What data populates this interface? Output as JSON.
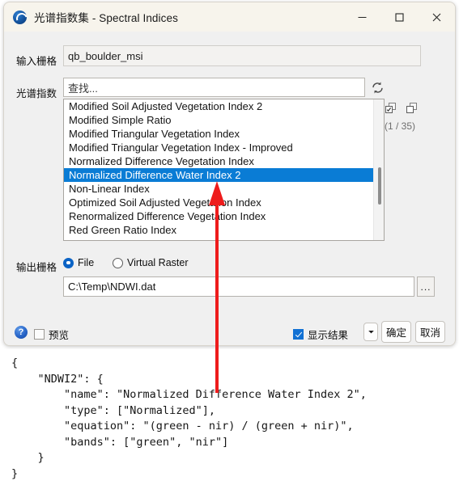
{
  "window": {
    "title": "光谱指数集 - Spectral Indices",
    "app_icon": "globe-swirl-icon",
    "controls": {
      "minimize": "minimize-icon",
      "maximize": "maximize-icon",
      "close": "close-icon"
    }
  },
  "form": {
    "input_raster_label": "输入栅格",
    "input_raster_value": "qb_boulder_msi",
    "spectral_index_label": "光谱指数",
    "search_placeholder": "查找...",
    "refresh_icon": "refresh-icon",
    "select_all_icon": "select-all-icon",
    "deselect_all_icon": "deselect-all-icon",
    "selection_count": "(1 / 35)",
    "list_items": [
      {
        "label": "Modified Soil Adjusted Vegetation Index 2",
        "selected": false
      },
      {
        "label": "Modified Simple Ratio",
        "selected": false
      },
      {
        "label": "Modified Triangular Vegetation Index",
        "selected": false
      },
      {
        "label": "Modified Triangular Vegetation Index - Improved",
        "selected": false
      },
      {
        "label": "Normalized Difference Vegetation Index",
        "selected": false
      },
      {
        "label": "Normalized Difference Water Index 2",
        "selected": true
      },
      {
        "label": "Non-Linear Index",
        "selected": false
      },
      {
        "label": "Optimized Soil Adjusted Vegetation Index",
        "selected": false
      },
      {
        "label": "Renormalized Difference Vegetation Index",
        "selected": false
      },
      {
        "label": "Red Green Ratio Index",
        "selected": false
      }
    ],
    "output_raster_label": "输出栅格",
    "output_file_option": "File",
    "output_virtual_option": "Virtual Raster",
    "output_selected": "File",
    "output_path": "C:\\Temp\\NDWI.dat",
    "browse_label": "..."
  },
  "footer": {
    "help_label": "?",
    "preview_label": "预览",
    "preview_checked": false,
    "display_result_label": "显示结果",
    "display_result_checked": true,
    "dropdown_icon": "chevron-down-icon",
    "ok_label": "确定",
    "cancel_label": "取消"
  },
  "code_block": {
    "text": "{\n    \"NDWI2\": {\n        \"name\": \"Normalized Difference Water Index 2\",\n        \"type\": [\"Normalized\"],\n        \"equation\": \"(green - nir) / (green + nir)\",\n        \"bands\": [\"green\", \"nir\"]\n    }\n}"
  },
  "annotation": {
    "arrow_color": "#ee1c1c",
    "arrow_name": "red-up-arrow-annotation"
  },
  "colors": {
    "accent_selection": "#0a7cd5",
    "titlebar": "#f7f4ec",
    "dialog_bg": "#f0f0f0",
    "radio_accent": "#0b63c5"
  }
}
